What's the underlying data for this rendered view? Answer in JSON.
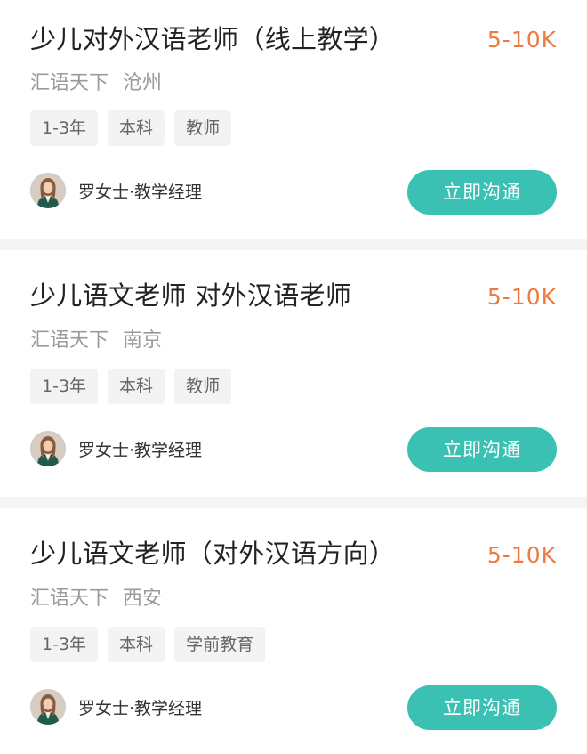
{
  "jobs": [
    {
      "title": "少儿对外汉语老师（线上教学）",
      "salary": "5-10K",
      "company": "汇语天下",
      "city": "沧州",
      "tags": [
        "1-3年",
        "本科",
        "教师"
      ],
      "recruiter": "罗女士·教学经理",
      "chat_label": "立即沟通"
    },
    {
      "title": "少儿语文老师 对外汉语老师",
      "salary": "5-10K",
      "company": "汇语天下",
      "city": "南京",
      "tags": [
        "1-3年",
        "本科",
        "教师"
      ],
      "recruiter": "罗女士·教学经理",
      "chat_label": "立即沟通"
    },
    {
      "title": "少儿语文老师（对外汉语方向）",
      "salary": "5-10K",
      "company": "汇语天下",
      "city": "西安",
      "tags": [
        "1-3年",
        "本科",
        "学前教育"
      ],
      "recruiter": "罗女士·教学经理",
      "chat_label": "立即沟通"
    }
  ],
  "colors": {
    "salary": "#f07a3e",
    "button": "#3bc1b4",
    "tag_bg": "#f3f3f3",
    "page_bg": "#f4f4f4"
  },
  "icons": {
    "avatar": "recruiter-avatar-photo"
  }
}
